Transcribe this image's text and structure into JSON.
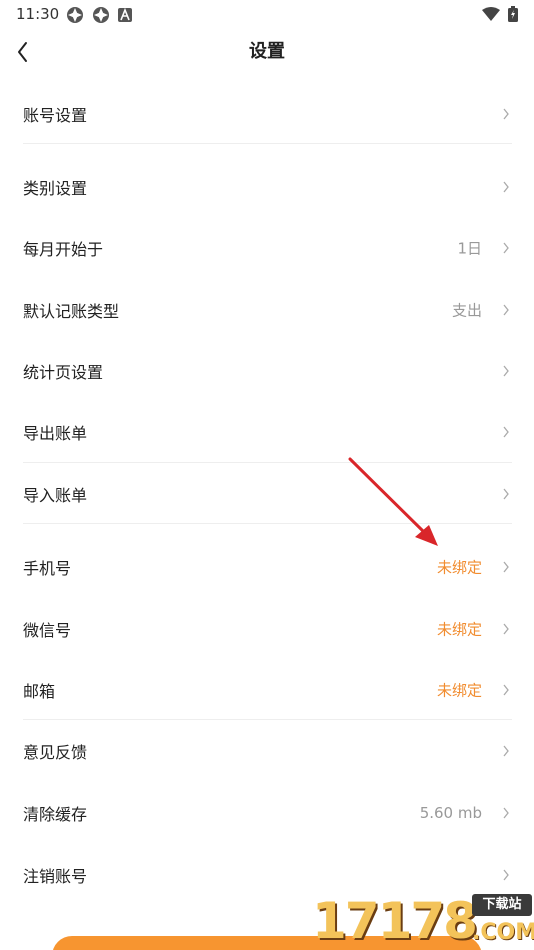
{
  "status_bar": {
    "time": "11:30"
  },
  "header": {
    "title": "设置"
  },
  "rows": [
    {
      "label": "账号设置",
      "value": ""
    },
    {
      "label": "类别设置",
      "value": ""
    },
    {
      "label": "每月开始于",
      "value": "1日"
    },
    {
      "label": "默认记账类型",
      "value": "支出"
    },
    {
      "label": "统计页设置",
      "value": ""
    },
    {
      "label": "导出账单",
      "value": ""
    },
    {
      "label": "导入账单",
      "value": ""
    },
    {
      "label": "手机号",
      "value": "未绑定"
    },
    {
      "label": "微信号",
      "value": "未绑定"
    },
    {
      "label": "邮箱",
      "value": "未绑定"
    },
    {
      "label": "意见反馈",
      "value": ""
    },
    {
      "label": "清除缓存",
      "value": "5.60 mb"
    },
    {
      "label": "注销账号",
      "value": ""
    }
  ],
  "watermark": {
    "digits": "17178",
    "tag": "下载站",
    "suffix": ".COM"
  },
  "colors": {
    "accent_orange": "#f18c2f",
    "button_orange": "#f79530",
    "annotation_arrow": "#d9262a"
  },
  "icons": {
    "status_left": [
      "app-notification-icon",
      "app-notification-icon",
      "a-notification-icon"
    ],
    "status_right": [
      "wifi-icon",
      "battery-charging-icon"
    ],
    "nav": "back-arrow-icon",
    "row": "chevron-right-icon"
  }
}
